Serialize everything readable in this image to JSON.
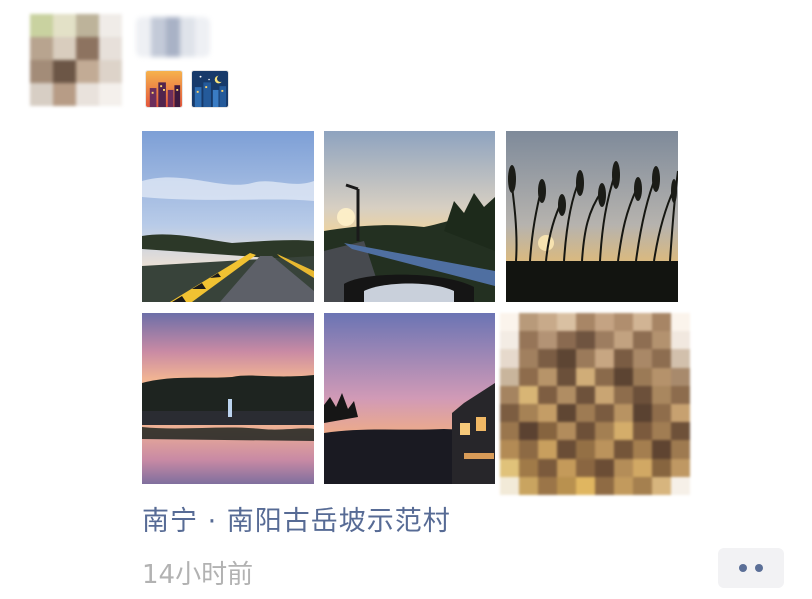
{
  "post": {
    "location": "南宁 · 南阳古岳坡示范村",
    "time": "14小时前",
    "emoji": [
      "sunset-city-emoji",
      "night-city-emoji"
    ],
    "photos": [
      "photo-bridge-road",
      "photo-streetlamp-road",
      "photo-reeds-silhouette",
      "photo-pink-sky-reflection",
      "photo-house-sunset",
      "photo-pixelated"
    ]
  },
  "colors": {
    "link": "#576b95",
    "time": "#b2b2b2",
    "more_button_bg": "#f2f2f4",
    "more_dots": "#5b6f97"
  }
}
